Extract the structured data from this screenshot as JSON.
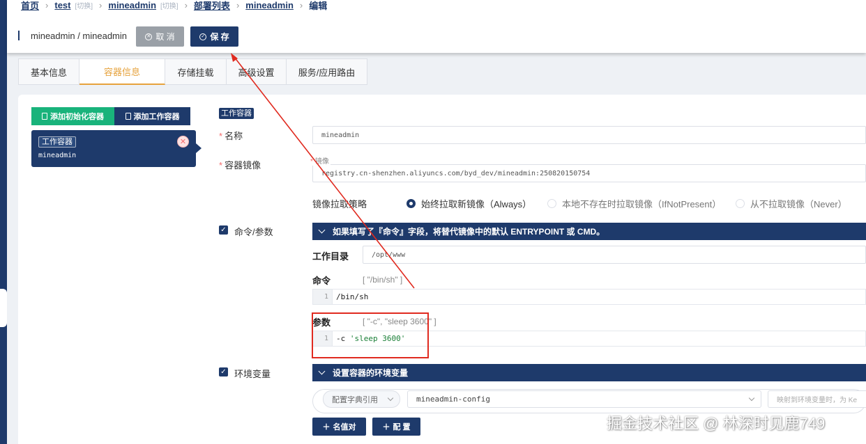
{
  "breadcrumb": {
    "items": [
      {
        "label": "首页",
        "switch": ""
      },
      {
        "label": "test",
        "switch": "[切换]"
      },
      {
        "label": "mineadmin",
        "switch": "[切换]"
      },
      {
        "label": "部署列表",
        "switch": ""
      },
      {
        "label": "mineadmin",
        "switch": ""
      },
      {
        "label": "编辑",
        "switch": ""
      }
    ]
  },
  "header": {
    "title": "mineadmin / mineadmin",
    "cancel_label": "取 消",
    "save_label": "保 存"
  },
  "tabs": [
    {
      "label": "基本信息",
      "active": false
    },
    {
      "label": "容器信息",
      "active": true
    },
    {
      "label": "存储挂载",
      "active": false
    },
    {
      "label": "高级设置",
      "active": false
    },
    {
      "label": "服务/应用路由",
      "active": false
    }
  ],
  "left": {
    "add_init_label": "添加初始化容器",
    "add_work_label": "添加工作容器",
    "card": {
      "tag": "工作容器",
      "name": "mineadmin"
    }
  },
  "form": {
    "section_tag": "工作容器",
    "name_label": "名称",
    "name_value": "mineadmin",
    "image_label": "容器镜像",
    "image_float_label": "镜像",
    "image_value": "registry.cn-shenzhen.aliyuncs.com/byd_dev/mineadmin:250820150754",
    "pull_policy_label": "镜像拉取策略",
    "pull_policies": [
      {
        "label": "始终拉取新镜像（Always）",
        "checked": true
      },
      {
        "label": "本地不存在时拉取镜像（IfNotPresent）",
        "checked": false
      },
      {
        "label": "从不拉取镜像（Never）",
        "checked": false
      }
    ]
  },
  "command": {
    "checkbox_label": "命令/参数",
    "bar_text": "如果填写了『命令』字段，将替代镜像中的默认 ENTRYPOINT 或 CMD。",
    "workdir_label": "工作目录",
    "workdir_value": "/opt/www",
    "cmd_label": "命令",
    "cmd_hint": "[ \"/bin/sh\" ]",
    "cmd_line_no": "1",
    "cmd_value": "/bin/sh",
    "args_label": "参数",
    "args_hint": "[ \"-c\", \"sleep 3600\" ]",
    "args_line_no": "1",
    "args_flag": "-c ",
    "args_string": "'sleep 3600'"
  },
  "env": {
    "checkbox_label": "环境变量",
    "bar_text": "设置容器的环境变量",
    "ref_type": "配置字典引用",
    "configmap": "mineadmin-config",
    "map_placeholder": "映射到环境变量时，为 Ke",
    "add_kv_label": "名值对",
    "add_config_label": "配 置"
  },
  "watermark": "掘金技术社区 @ 林深时见鹿749",
  "colors": {
    "primary": "#1e3a6b",
    "active_tab": "#e6a23c",
    "green": "#19b37b",
    "annotation": "#e02a1f"
  }
}
